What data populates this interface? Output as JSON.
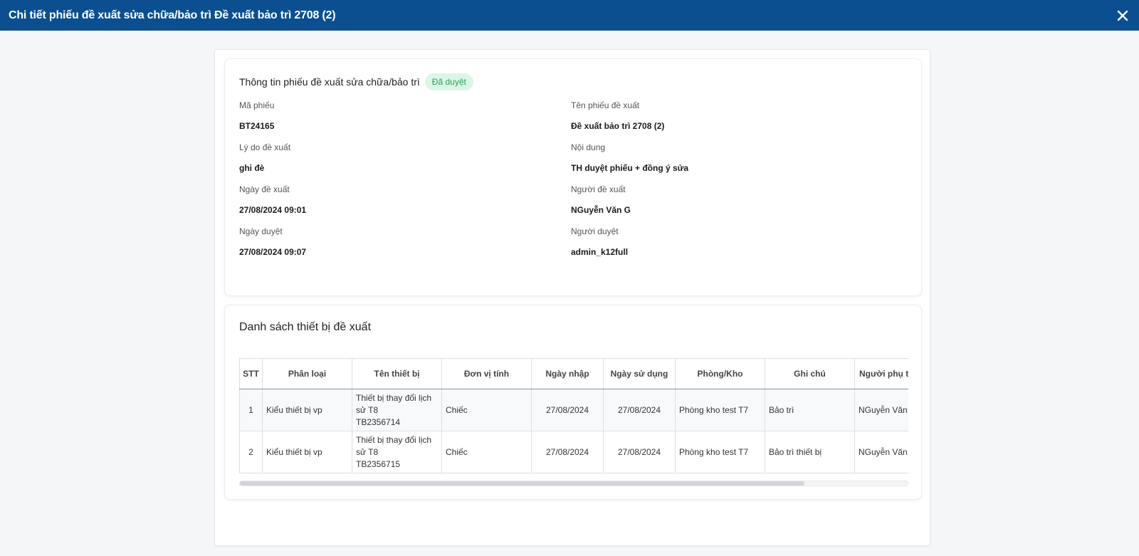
{
  "header": {
    "title": "Chi tiết phiếu đề xuất sửa chữa/bảo trì Đề xuất bảo trì 2708 (2)",
    "close_icon": "close-icon"
  },
  "info": {
    "title": "Thông tin phiếu đề xuất sửa chữa/bảo trì",
    "status": "Đã duyệt",
    "status_color": "#22a356",
    "fields": [
      {
        "label": "Mã phiếu",
        "value": "BT24165"
      },
      {
        "label": "Tên phiếu đề xuất",
        "value": "Đề xuất bảo trì 2708 (2)"
      },
      {
        "label": "Lý do đề xuất",
        "value": "ghi đè"
      },
      {
        "label": "Nội dung",
        "value": "TH duyệt phiếu + đồng ý sửa"
      },
      {
        "label": "Ngày đề xuất",
        "value": "27/08/2024 09:01"
      },
      {
        "label": "Người đề xuất",
        "value": "NGuyễn Văn G"
      },
      {
        "label": "Ngày duyệt",
        "value": "27/08/2024 09:07"
      },
      {
        "label": "Người duyệt",
        "value": "admin_k12full"
      }
    ]
  },
  "devices": {
    "title": "Danh sách thiết bị đề xuất",
    "columns": [
      "STT",
      "Phân loại",
      "Tên thiết bị",
      "Đơn vị tính",
      "Ngày nhập",
      "Ngày sử dụng",
      "Phòng/Kho",
      "Ghi chú",
      "Người phụ trách sửa chữa"
    ],
    "rows": [
      {
        "stt": "1",
        "category": "Kiểu thiết bị vp",
        "name": "Thiết bị thay đổi lịch sử T8",
        "code": "TB2356714",
        "unit": "Chiếc",
        "import_date": "27/08/2024",
        "use_date": "27/08/2024",
        "room": "Phòng kho test T7",
        "note": "Bảo trì",
        "person": "NGuyễn Văn G"
      },
      {
        "stt": "2",
        "category": "Kiểu thiết bị vp",
        "name": "Thiết bị thay đổi lịch sử T8",
        "code": "TB2356715",
        "unit": "Chiếc",
        "import_date": "27/08/2024",
        "use_date": "27/08/2024",
        "room": "Phòng kho test T7",
        "note": "Bảo trì thiết bị",
        "person": "NGuyễn Văn G"
      }
    ],
    "scroll_position": 0.84
  }
}
